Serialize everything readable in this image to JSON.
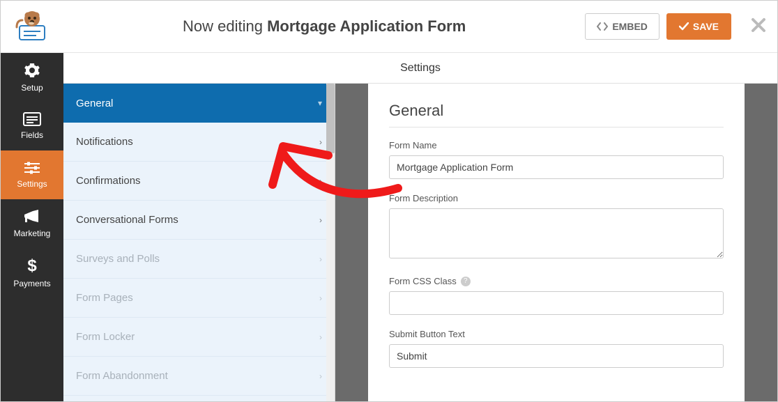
{
  "topbar": {
    "title_prefix": "Now editing",
    "title_bold": "Mortgage Application Form",
    "embed_label": "EMBED",
    "save_label": "SAVE"
  },
  "sidebar": {
    "items": [
      {
        "label": "Setup",
        "active": false
      },
      {
        "label": "Fields",
        "active": false
      },
      {
        "label": "Settings",
        "active": true
      },
      {
        "label": "Marketing",
        "active": false
      },
      {
        "label": "Payments",
        "active": false
      }
    ]
  },
  "subheader": {
    "title": "Settings"
  },
  "settings_panel": {
    "items": [
      {
        "label": "General",
        "active": true,
        "disabled": false
      },
      {
        "label": "Notifications",
        "active": false,
        "disabled": false
      },
      {
        "label": "Confirmations",
        "active": false,
        "disabled": false
      },
      {
        "label": "Conversational Forms",
        "active": false,
        "disabled": false
      },
      {
        "label": "Surveys and Polls",
        "active": false,
        "disabled": true
      },
      {
        "label": "Form Pages",
        "active": false,
        "disabled": true
      },
      {
        "label": "Form Locker",
        "active": false,
        "disabled": true
      },
      {
        "label": "Form Abandonment",
        "active": false,
        "disabled": true
      }
    ]
  },
  "form": {
    "section_title": "General",
    "name_label": "Form Name",
    "name_value": "Mortgage Application Form",
    "description_label": "Form Description",
    "description_value": "",
    "css_label": "Form CSS Class",
    "css_value": "",
    "submit_label": "Submit Button Text",
    "submit_value": "Submit"
  }
}
